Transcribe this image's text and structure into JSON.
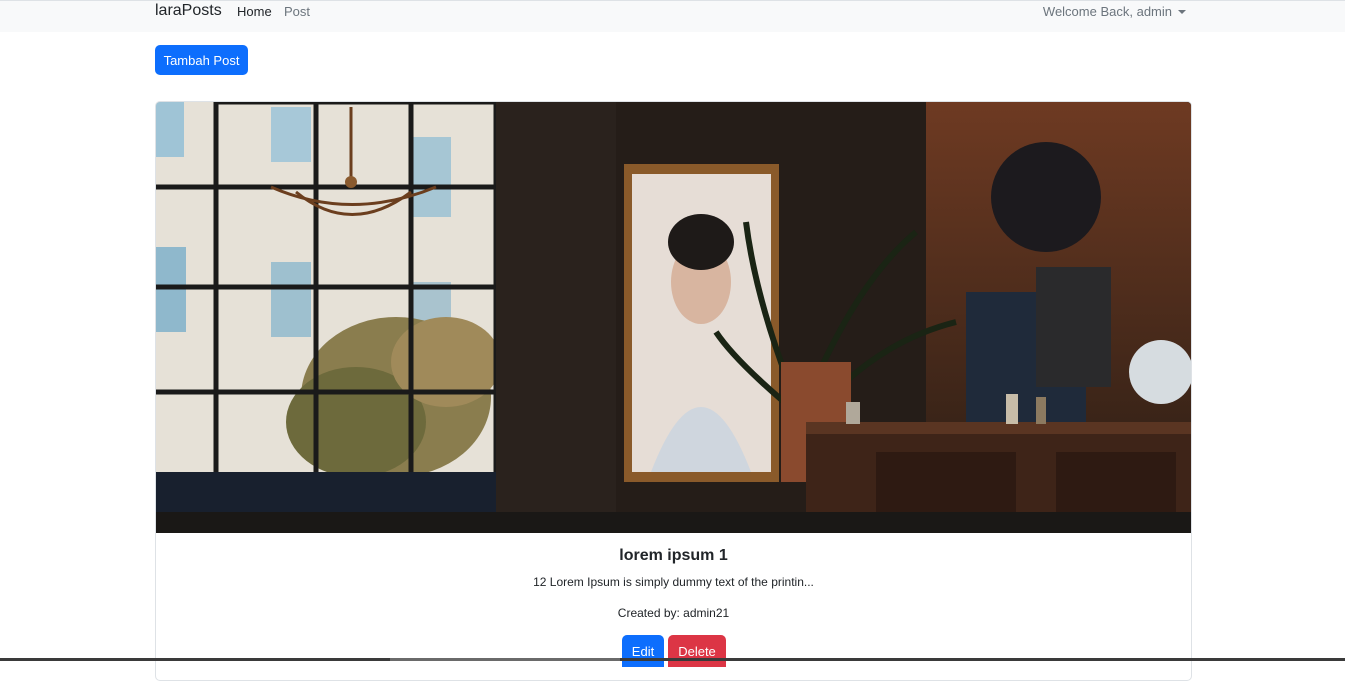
{
  "navbar": {
    "brand": "laraPosts",
    "links": [
      {
        "label": "Home",
        "active": true
      },
      {
        "label": "Post",
        "active": false
      }
    ],
    "user_menu_label": "Welcome Back, admin"
  },
  "actions": {
    "add_post_label": "Tambah Post"
  },
  "post": {
    "title": "lorem ipsum 1",
    "excerpt": "12 Lorem Ipsum is simply dummy text of the printin...",
    "created_by": "Created by: admin21",
    "edit_label": "Edit",
    "delete_label": "Delete",
    "image_description": "cafe interior photo with window, chandelier, portrait painting and plants"
  },
  "colors": {
    "primary": "#0d6efd",
    "danger": "#dc3545",
    "navbar_bg": "#f8f9fa"
  }
}
